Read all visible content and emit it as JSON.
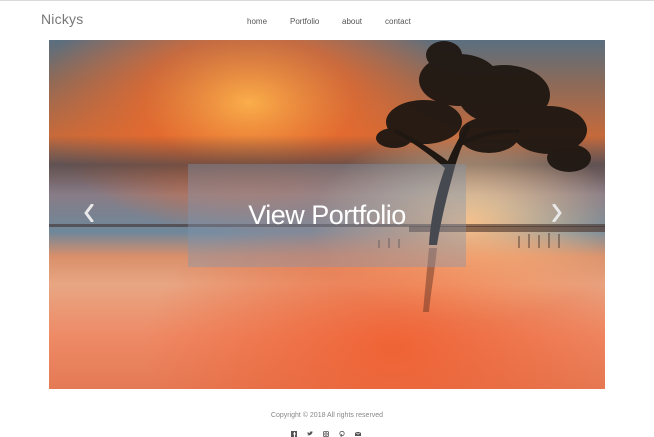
{
  "brand": {
    "name": "Nickys"
  },
  "nav": {
    "items": [
      {
        "label": "home"
      },
      {
        "label": "Portfolio"
      },
      {
        "label": "about"
      },
      {
        "label": "contact"
      }
    ]
  },
  "hero": {
    "cta_label": "View Portfolio",
    "image": "sunset-lake-tree-photo",
    "prev_icon": "chevron-left-icon",
    "next_icon": "chevron-right-icon"
  },
  "footer": {
    "copyright": "Copyright © 2018 All rights reserved",
    "social_icons": [
      "facebook-icon",
      "twitter-icon",
      "instagram-icon",
      "pinterest-icon",
      "email-icon"
    ]
  },
  "colors": {
    "sky_orange": "#f07a33",
    "sky_blue": "#6f8fa4",
    "water_peach": "#f0a07d",
    "tree_dark": "#1f1712"
  }
}
